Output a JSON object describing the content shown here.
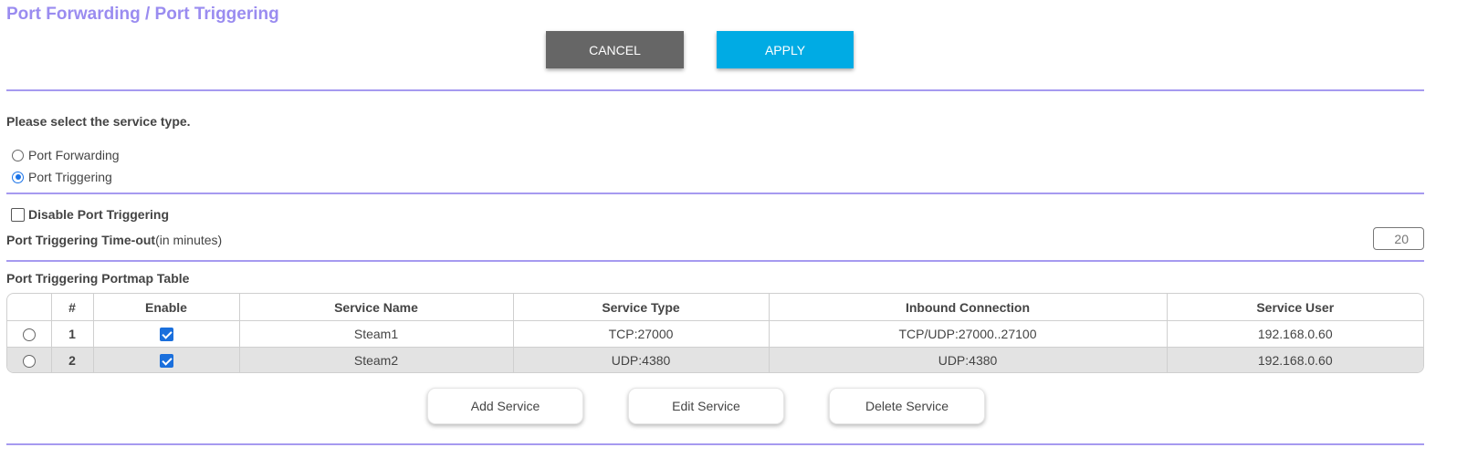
{
  "page": {
    "title": "Port Forwarding / Port Triggering",
    "cancel_label": "CANCEL",
    "apply_label": "APPLY"
  },
  "service_type": {
    "prompt": "Please select the service type.",
    "options": [
      {
        "label": "Port Forwarding",
        "selected": false
      },
      {
        "label": "Port Triggering",
        "selected": true
      }
    ]
  },
  "trigger": {
    "disable_label": "Disable Port Triggering",
    "disable_checked": false,
    "timeout_label": "Port Triggering Time-out",
    "timeout_unit": "(in minutes)",
    "timeout_value": "20"
  },
  "table": {
    "title": "Port Triggering Portmap Table",
    "columns": [
      "#",
      "Enable",
      "Service Name",
      "Service Type",
      "Inbound Connection",
      "Service User"
    ],
    "rows": [
      {
        "num": "1",
        "enabled": true,
        "name": "Steam1",
        "type": "TCP:27000",
        "inbound": "TCP/UDP:27000..27100",
        "user": "192.168.0.60"
      },
      {
        "num": "2",
        "enabled": true,
        "name": "Steam2",
        "type": "UDP:4380",
        "inbound": "UDP:4380",
        "user": "192.168.0.60"
      }
    ]
  },
  "actions": {
    "add_label": "Add Service",
    "edit_label": "Edit Service",
    "delete_label": "Delete Service"
  },
  "colors": {
    "title": "#9a8cf0",
    "divider": "#a69af0",
    "cancel": "#666666",
    "apply": "#00abe4",
    "checkbox": "#1a6fdc"
  }
}
